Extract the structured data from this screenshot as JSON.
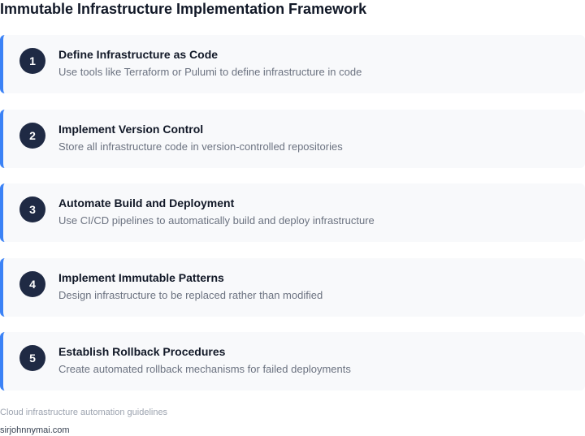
{
  "header": {
    "title": "Immutable Infrastructure Implementation Framework"
  },
  "steps": [
    {
      "number": "1",
      "title": "Define Infrastructure as Code",
      "description": "Use tools like Terraform or Pulumi to define infrastructure in code"
    },
    {
      "number": "2",
      "title": "Implement Version Control",
      "description": "Store all infrastructure code in version-controlled repositories"
    },
    {
      "number": "3",
      "title": "Automate Build and Deployment",
      "description": "Use CI/CD pipelines to automatically build and deploy infrastructure"
    },
    {
      "number": "4",
      "title": "Implement Immutable Patterns",
      "description": "Design infrastructure to be replaced rather than modified"
    },
    {
      "number": "5",
      "title": "Establish Rollback Procedures",
      "description": "Create automated rollback mechanisms for failed deployments"
    }
  ],
  "footer": {
    "note": "Cloud infrastructure automation guidelines",
    "site": "sirjohnnymai.com"
  },
  "colors": {
    "accent": "#3b82f6",
    "badge": "#1f2a44",
    "card_background": "#f8f9fb"
  }
}
